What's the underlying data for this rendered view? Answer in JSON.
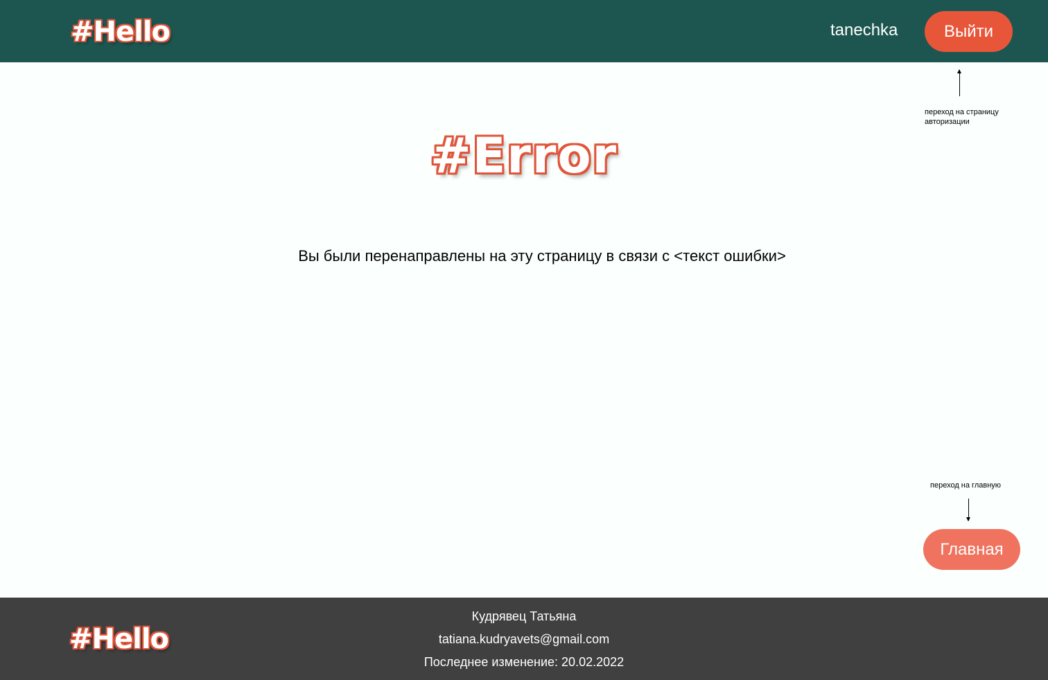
{
  "header": {
    "logo": "#Hello",
    "username": "tanechka",
    "logout_label": "Выйти",
    "background_color": "#1d5650"
  },
  "annotations": {
    "logout_note_line1": "переход на страницу",
    "logout_note_line2": "авторизации",
    "home_note": "переход на главную"
  },
  "main": {
    "error_title": "#Error",
    "error_message": "Вы были перенаправлены на эту страницу в связи с <текст ошибки>",
    "home_label": "Главная"
  },
  "footer": {
    "logo": "#Hello",
    "author": "Кудрявец Татьяна",
    "email": "tatiana.kudryavets@gmail.com",
    "last_modified": "Последнее изменение: 20.02.2022",
    "background_color": "#404040"
  },
  "colors": {
    "accent": "#e8563a",
    "home_button": "#ef735e",
    "page_background": "#fbfffd"
  }
}
